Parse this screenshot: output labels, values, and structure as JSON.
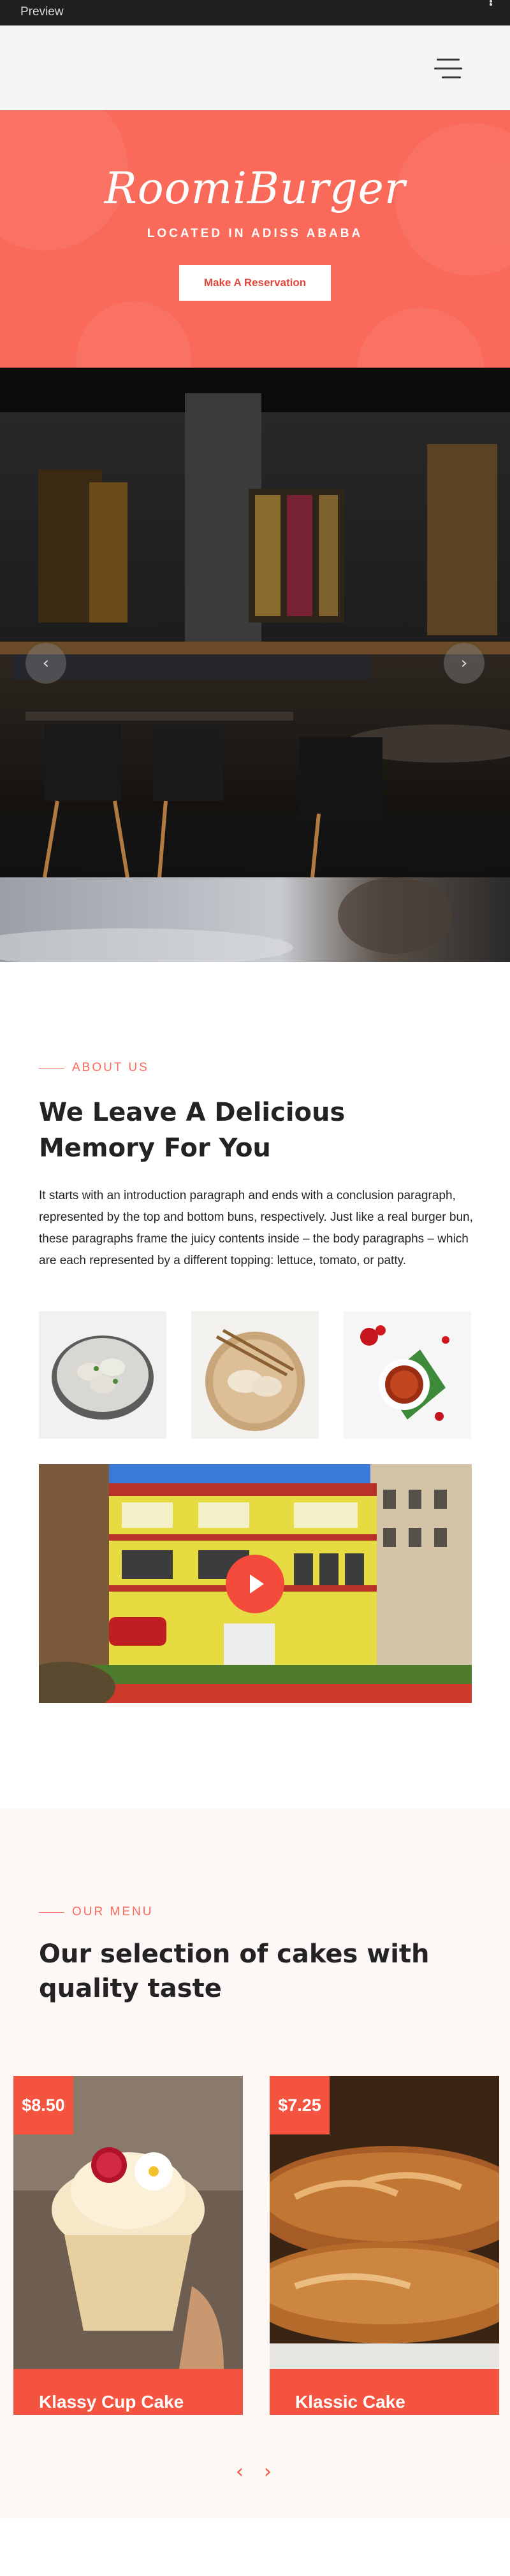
{
  "preview_bar": {
    "label": "Preview",
    "menu_icon": "more-vertical-icon"
  },
  "header": {
    "menu_icon": "hamburger-icon"
  },
  "hero": {
    "brand": "RoomiBurger",
    "location": "LOCATED IN ADISS ABABA",
    "cta_label": "Make A Reservation",
    "background_color": "#f96a5a"
  },
  "slider": {
    "prev_icon": "chevron-left-icon",
    "next_icon": "chevron-right-icon"
  },
  "about": {
    "eyebrow": "ABOUT US",
    "title": "We Leave A Delicious Memory For You",
    "text": "It starts with an introduction paragraph and ends with a conclusion paragraph, represented by the top and bottom buns, respectively. Just like a real burger bun, these paragraphs frame the juicy contents inside – the body paragraphs – which are each represented by a different topping: lettuce, tomato, or patty.",
    "video_icon": "play-icon"
  },
  "menu": {
    "eyebrow": "OUR MENU",
    "title": "Our selection of cakes with quality taste",
    "items": [
      {
        "price": "$8.50",
        "name": "Klassy Cup Cake"
      },
      {
        "price": "$7.25",
        "name": "Klassic Cake"
      }
    ],
    "prev_label": "‹",
    "next_label": "›"
  },
  "colors": {
    "accent": "#f4543f",
    "hero": "#f96a5a",
    "menu_bg": "#fdf7f6"
  }
}
